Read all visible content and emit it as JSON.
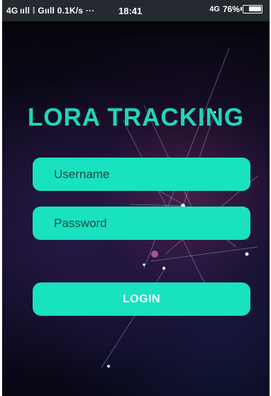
{
  "status_bar": {
    "signal_text": "4G ııll ⁞ Gııll 0.1K/s ···",
    "time": "18:41",
    "network": "4G",
    "battery": "76%",
    "battery_level": 0.76
  },
  "app": {
    "title": "LORA TRACKING"
  },
  "login_form": {
    "username_placeholder": "Username",
    "password_placeholder": "Password",
    "login_label": "LOGIN"
  },
  "colors": {
    "accent": "#19e2bf",
    "title": "#1fd6b8",
    "background": "#0a0a18"
  }
}
